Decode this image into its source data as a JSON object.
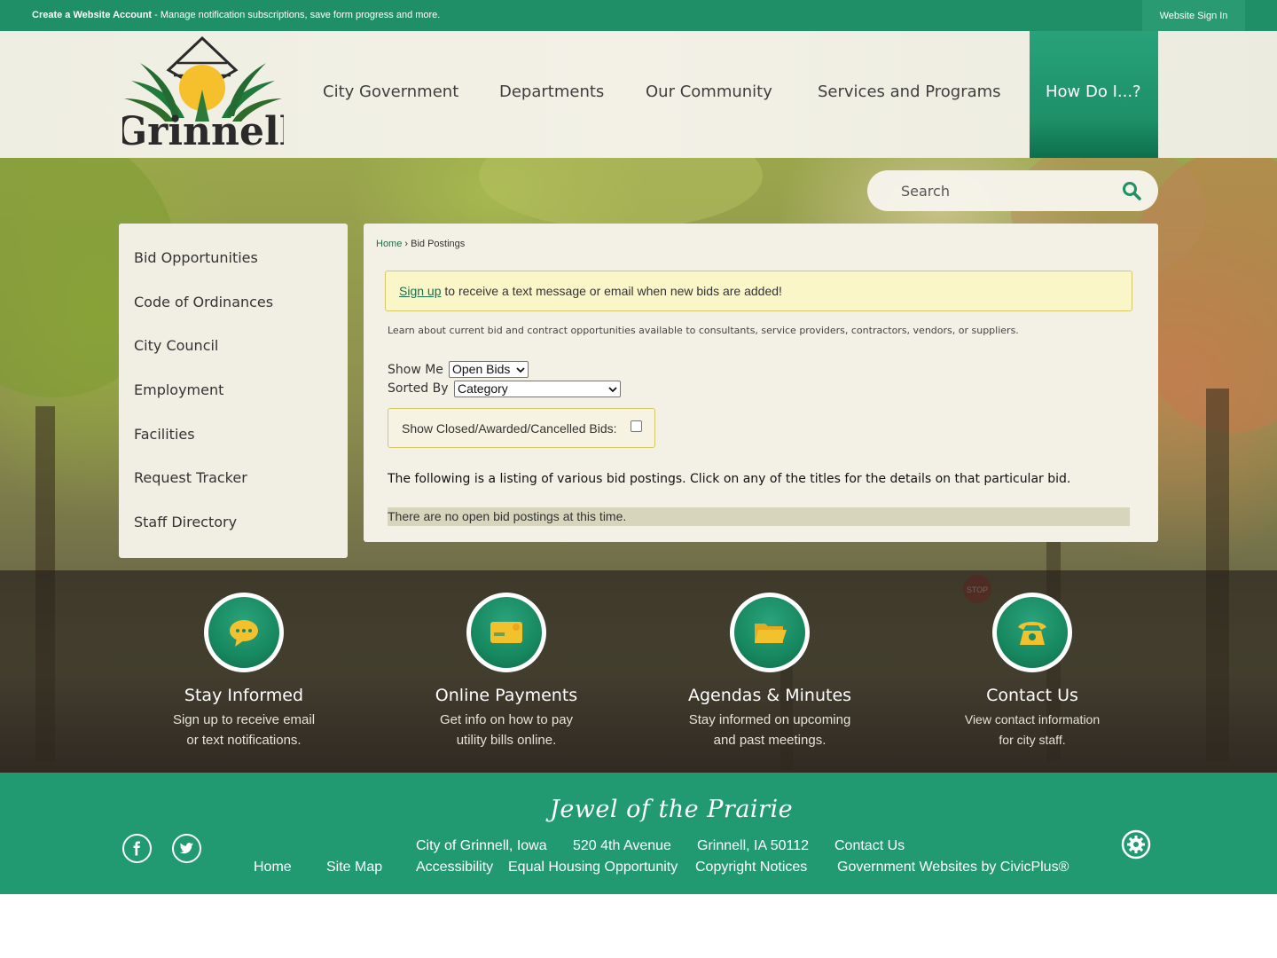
{
  "topbar": {
    "create_label": "Create a Website Account",
    "create_suffix": " - Manage notification subscriptions, save form progress and more.",
    "signin_label": "Website Sign In"
  },
  "logo": {
    "text": "Grinnell"
  },
  "nav": {
    "items": [
      "City Government",
      "Departments",
      "Our Community",
      "Services and Programs",
      "How Do I...?"
    ]
  },
  "search": {
    "placeholder": "Search"
  },
  "sidebar": {
    "items": [
      "Bid Opportunities",
      "Code of Ordinances",
      "City Council",
      "Employment",
      "Facilities",
      "Request Tracker",
      "Staff Directory"
    ]
  },
  "main": {
    "breadcrumb": {
      "home": "Home",
      "separator": "›",
      "current": "Bid Postings"
    },
    "alert": {
      "link": "Sign up",
      "text": " to receive a text message or email when new bids are added!"
    },
    "learn": "Learn about current bid and contract opportunities available to consultants, service providers, contractors, vendors, or suppliers.",
    "show_me_label": "Show Me",
    "show_me_value": "Open Bids",
    "sorted_by_label": "Sorted By",
    "sorted_by_value": "Category",
    "closed_label": "Show Closed/Awarded/Cancelled Bids:",
    "closed_checked": false,
    "following": "The following is a listing of various bid postings. Click on any of the titles for the details on that particular bid.",
    "no_bids": "There are no open bid postings at this time."
  },
  "quick_links": [
    {
      "title": "Stay Informed",
      "desc1": "Sign up to receive email",
      "desc2": "or text notifications.",
      "icon": "speech-bubble-icon"
    },
    {
      "title": "Online Payments",
      "desc1": "Get info on how to pay",
      "desc2": "utility bills online.",
      "icon": "credit-card-icon"
    },
    {
      "title": "Agendas & Minutes",
      "desc1": "Stay informed on upcoming",
      "desc2": "and past meetings.",
      "icon": "folder-icon"
    },
    {
      "title": "Contact Us",
      "desc1": "View contact information",
      "desc2": "for city staff.",
      "icon": "telephone-icon"
    }
  ],
  "footer": {
    "tagline": "Jewel of the Prairie",
    "city": "City of Grinnell, Iowa",
    "address": "520 4th Avenue",
    "citystate": "Grinnell, IA 50112",
    "contact": "Contact Us",
    "home": "Home",
    "sitemap": "Site Map",
    "accessibility": "Accessibility",
    "equal_housing": "Equal Housing Opportunity",
    "copyright": "Copyright Notices",
    "civicplus": "Government Websites by CivicPlus®"
  },
  "colors": {
    "brand_green": "#229a71",
    "topbar_green": "#1f8f68",
    "alert_yellow": "#fbf6c8",
    "icon_gold": "#f2c12e"
  }
}
